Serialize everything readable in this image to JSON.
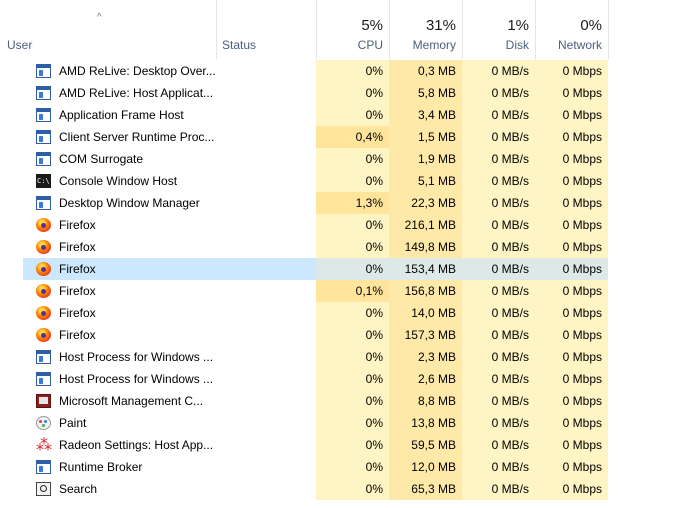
{
  "header": {
    "sort_arrow": "^",
    "columns": {
      "user": {
        "label": "User"
      },
      "status": {
        "label": "Status"
      },
      "cpu": {
        "pct": "5%",
        "label": "CPU"
      },
      "memory": {
        "pct": "31%",
        "label": "Memory"
      },
      "disk": {
        "pct": "1%",
        "label": "Disk"
      },
      "network": {
        "pct": "0%",
        "label": "Network"
      }
    }
  },
  "processes": [
    {
      "name": "AMD ReLive: Desktop Over...",
      "icon": "window-icon",
      "cpu": "0%",
      "mem": "0,3 MB",
      "disk": "0 MB/s",
      "net": "0 Mbps"
    },
    {
      "name": "AMD ReLive: Host Applicat...",
      "icon": "window-icon",
      "cpu": "0%",
      "mem": "5,8 MB",
      "disk": "0 MB/s",
      "net": "0 Mbps"
    },
    {
      "name": "Application Frame Host",
      "icon": "window-icon",
      "cpu": "0%",
      "mem": "3,4 MB",
      "disk": "0 MB/s",
      "net": "0 Mbps"
    },
    {
      "name": "Client Server Runtime Proc...",
      "icon": "window-icon",
      "cpu": "0,4%",
      "mem": "1,5 MB",
      "disk": "0 MB/s",
      "net": "0 Mbps"
    },
    {
      "name": "COM Surrogate",
      "icon": "window-icon",
      "cpu": "0%",
      "mem": "1,9 MB",
      "disk": "0 MB/s",
      "net": "0 Mbps"
    },
    {
      "name": "Console Window Host",
      "icon": "console-icon",
      "cpu": "0%",
      "mem": "5,1 MB",
      "disk": "0 MB/s",
      "net": "0 Mbps"
    },
    {
      "name": "Desktop Window Manager",
      "icon": "window-icon",
      "cpu": "1,3%",
      "mem": "22,3 MB",
      "disk": "0 MB/s",
      "net": "0 Mbps"
    },
    {
      "name": "Firefox",
      "icon": "firefox-icon",
      "cpu": "0%",
      "mem": "216,1 MB",
      "disk": "0 MB/s",
      "net": "0 Mbps"
    },
    {
      "name": "Firefox",
      "icon": "firefox-icon",
      "cpu": "0%",
      "mem": "149,8 MB",
      "disk": "0 MB/s",
      "net": "0 Mbps"
    },
    {
      "name": "Firefox",
      "icon": "firefox-icon",
      "cpu": "0%",
      "mem": "153,4 MB",
      "disk": "0 MB/s",
      "net": "0 Mbps",
      "selected": true
    },
    {
      "name": "Firefox",
      "icon": "firefox-icon",
      "cpu": "0,1%",
      "mem": "156,8 MB",
      "disk": "0 MB/s",
      "net": "0 Mbps"
    },
    {
      "name": "Firefox",
      "icon": "firefox-icon",
      "cpu": "0%",
      "mem": "14,0 MB",
      "disk": "0 MB/s",
      "net": "0 Mbps"
    },
    {
      "name": "Firefox",
      "icon": "firefox-icon",
      "cpu": "0%",
      "mem": "157,3 MB",
      "disk": "0 MB/s",
      "net": "0 Mbps"
    },
    {
      "name": "Host Process for Windows ...",
      "icon": "window-icon",
      "cpu": "0%",
      "mem": "2,3 MB",
      "disk": "0 MB/s",
      "net": "0 Mbps"
    },
    {
      "name": "Host Process for Windows ...",
      "icon": "window-icon",
      "cpu": "0%",
      "mem": "2,6 MB",
      "disk": "0 MB/s",
      "net": "0 Mbps"
    },
    {
      "name": "Microsoft Management C...",
      "icon": "mmc-icon",
      "cpu": "0%",
      "mem": "8,8 MB",
      "disk": "0 MB/s",
      "net": "0 Mbps"
    },
    {
      "name": "Paint",
      "icon": "paint-icon",
      "cpu": "0%",
      "mem": "13,8 MB",
      "disk": "0 MB/s",
      "net": "0 Mbps"
    },
    {
      "name": "Radeon Settings: Host App...",
      "icon": "radeon-icon",
      "cpu": "0%",
      "mem": "59,5 MB",
      "disk": "0 MB/s",
      "net": "0 Mbps"
    },
    {
      "name": "Runtime Broker",
      "icon": "window-icon",
      "cpu": "0%",
      "mem": "12,0 MB",
      "disk": "0 MB/s",
      "net": "0 Mbps"
    },
    {
      "name": "Search",
      "icon": "search-icon",
      "cpu": "0%",
      "mem": "65,3 MB",
      "disk": "0 MB/s",
      "net": "0 Mbps"
    }
  ],
  "colors": {
    "heat_light": "#fff4c4",
    "heat_mid": "#ffe9a8",
    "heat_dark": "#ffe49c",
    "selected_row": "#cce8ff",
    "header_label": "#4c607a"
  }
}
